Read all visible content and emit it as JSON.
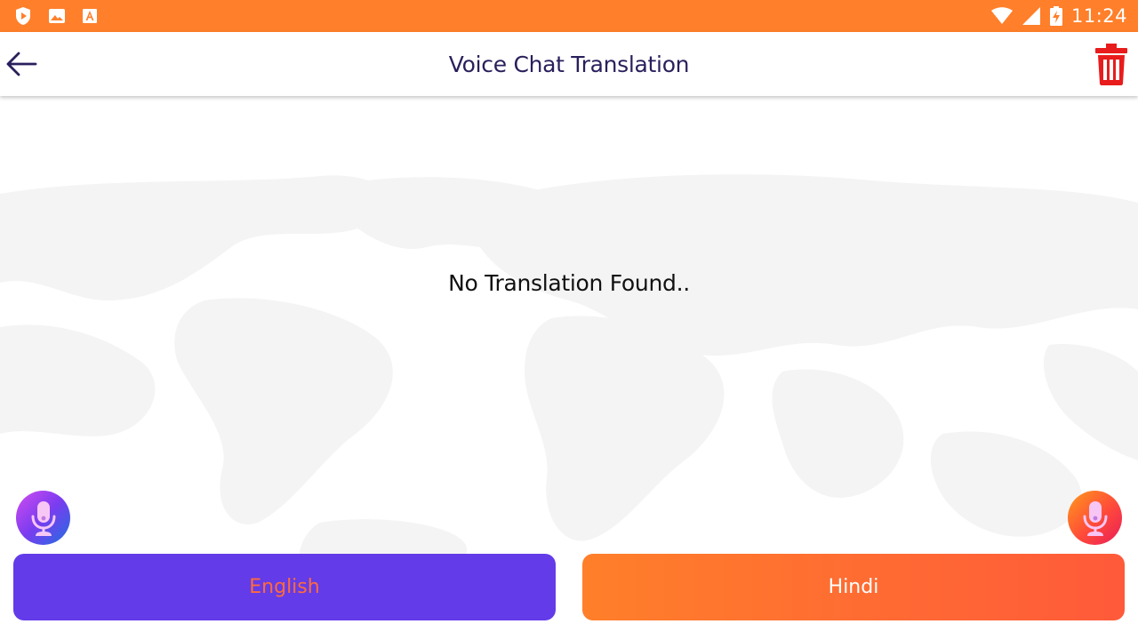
{
  "status_bar": {
    "time": "11:24",
    "left_icons": [
      "shield-play-icon",
      "image-icon",
      "font-a-icon"
    ],
    "right_icons": [
      "wifi-icon",
      "signal-icon",
      "battery-charging-icon"
    ],
    "background": "#ff7f2a"
  },
  "app_bar": {
    "title": "Voice Chat Translation",
    "back_icon": "arrow-left-icon",
    "delete_icon": "trash-icon",
    "title_color": "#2a1f5c",
    "delete_color": "#e81c1c"
  },
  "main": {
    "empty_message": "No Translation Found.."
  },
  "languages": {
    "source": {
      "label": "English",
      "mic_icon": "microphone-icon",
      "color": "#633be8",
      "text_color": "#ff6a3d"
    },
    "target": {
      "label": "Hindi",
      "mic_icon": "microphone-icon",
      "color": "#ff7f2a",
      "text_color": "#ffffff"
    }
  }
}
